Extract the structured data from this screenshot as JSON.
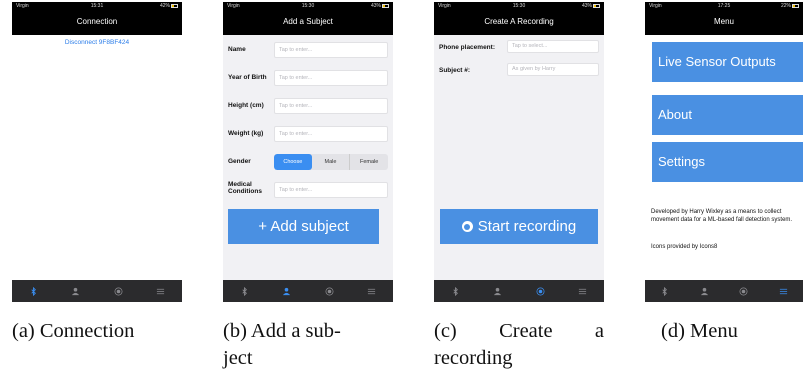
{
  "panels": {
    "connection": {
      "status": {
        "carrier": "Virgin",
        "time": "15:31",
        "battery": "42%"
      },
      "title": "Connection",
      "disconnect_label": "Disconnect 9F8BF424",
      "active_tab": "bluetooth",
      "caption": "(a) Connection"
    },
    "add_subject": {
      "status": {
        "carrier": "Virgin",
        "time": "15:30",
        "battery": "43%"
      },
      "title": "Add a Subject",
      "fields": [
        {
          "label": "Name",
          "placeholder": "Tap to enter..."
        },
        {
          "label": "Year of Birth",
          "placeholder": "Tap to enter..."
        },
        {
          "label": "Height (cm)",
          "placeholder": "Tap to enter..."
        },
        {
          "label": "Weight (kg)",
          "placeholder": "Tap to enter..."
        }
      ],
      "gender": {
        "label": "Gender",
        "options": [
          "Choose",
          "Male",
          "Female"
        ],
        "selected": "Choose"
      },
      "medical": {
        "label_line1": "Medical",
        "label_line2": "Conditions",
        "placeholder": "Tap to enter..."
      },
      "button_label": "+ Add subject",
      "active_tab": "person",
      "caption_line1": "(b) Add a sub-",
      "caption_line2": "ject"
    },
    "create_recording": {
      "status": {
        "carrier": "Virgin",
        "time": "15:30",
        "battery": "43%"
      },
      "title": "Create A Recording",
      "phone_placement": {
        "label": "Phone placement:",
        "placeholder": "Tap to select..."
      },
      "subject": {
        "label": "Subject #:",
        "placeholder": "As given by Harry"
      },
      "button_label": "Start recording",
      "active_tab": "record",
      "caption_w1": "(c)",
      "caption_w2": "Create",
      "caption_w3": "a",
      "caption_line2": "recording"
    },
    "menu": {
      "status": {
        "carrier": "Virgin",
        "time": "17:25",
        "battery": "22%"
      },
      "title": "Menu",
      "items": [
        "Live Sensor Outputs",
        "About",
        "Settings"
      ],
      "description": "Developed by Harry Wixley as a means to collect movement data for a ML-based fall detection system.",
      "credit": "Icons provided by Icons8",
      "active_tab": "menu",
      "caption": "(d) Menu"
    }
  },
  "tab_icons": [
    "bluetooth-icon",
    "person-icon",
    "record-icon",
    "menu-icon"
  ],
  "colors": {
    "accent": "#4a90e2",
    "tab_active": "#3a8ef1",
    "tab_inactive": "#8a8a8e",
    "bar": "#000000",
    "tabbar": "#2b2b2d"
  }
}
